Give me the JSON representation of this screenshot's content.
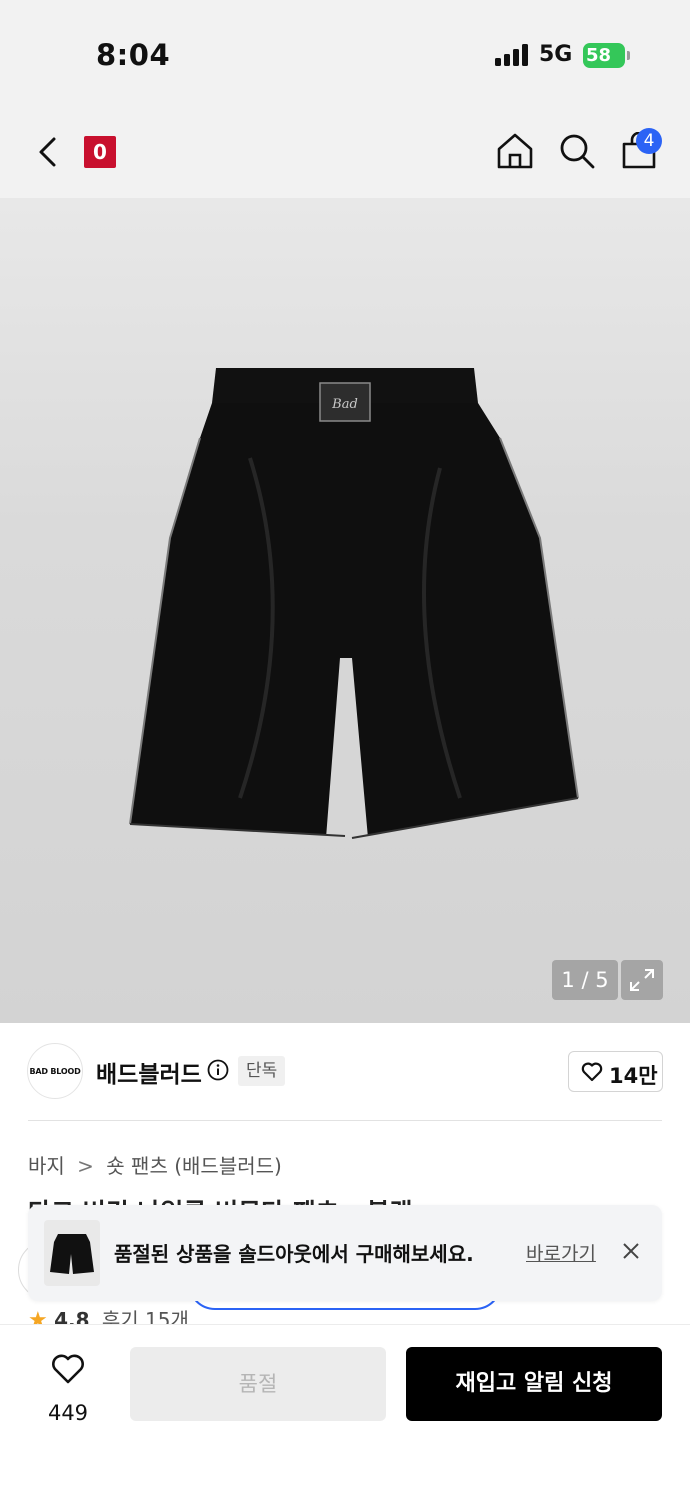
{
  "status_bar": {
    "time": "8:04",
    "network": "5G",
    "battery": "58"
  },
  "header": {
    "back_icon": "chevron-left-icon",
    "brand_logo_text": "0",
    "home_icon": "home-icon",
    "search_icon": "search-icon",
    "cart_icon": "shopping-bag-icon",
    "cart_count": "4"
  },
  "gallery": {
    "counter": "1 / 5",
    "expand_icon": "expand-icon",
    "patch_text": "Bad"
  },
  "brand": {
    "avatar_text": "BAD BLOOD",
    "name": "배드블러드",
    "info_icon": "info-icon",
    "tag": "단독",
    "likes": "14만"
  },
  "category": {
    "level1": "바지",
    "separator": ">",
    "level2": "숏 팬츠 (배드블러드)"
  },
  "product": {
    "title_partial": "다크 버킹 나일론 버뮤다 팬츠 - 블랙"
  },
  "rating": {
    "score": "4.8",
    "reviews": "후기 15개"
  },
  "toast": {
    "message": "품절된 상품을 솔드아웃에서 구매해보세요.",
    "link": "바로가기",
    "close_icon": "close-icon"
  },
  "bottom_bar": {
    "wish_count": "449",
    "soldout_label": "품절",
    "restock_label": "재입고 알림 신청"
  },
  "colors": {
    "accent_blue": "#2b63f5",
    "brand_red": "#c8102e",
    "battery_green": "#34c759"
  }
}
